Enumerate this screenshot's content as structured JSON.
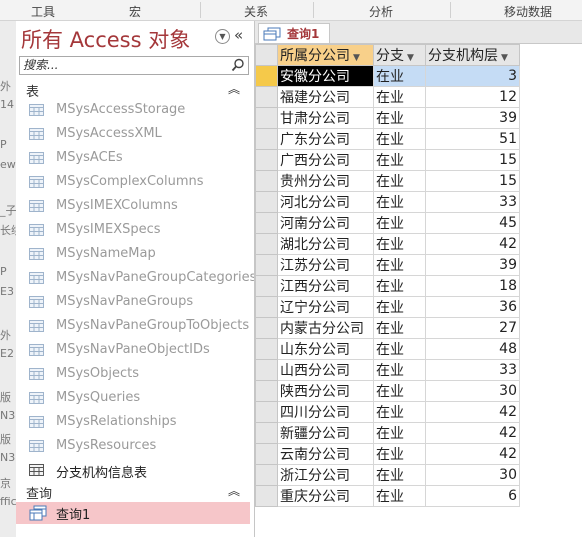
{
  "ribbon": {
    "groups": [
      "工具",
      "宏",
      "关系",
      "分析",
      "移动数据"
    ]
  },
  "left_strip": {
    "fragments": [
      "外",
      "14",
      "P",
      "ew",
      "_子",
      "长续",
      "P",
      "E3",
      "外",
      "E2",
      "版",
      "N3",
      "版",
      "N3",
      "京",
      "ffic"
    ]
  },
  "nav": {
    "title": "所有 Access 对象",
    "search_placeholder": "搜索...",
    "tables_header": "表",
    "tables": [
      "MSysAccessStorage",
      "MSysAccessXML",
      "MSysACEs",
      "MSysComplexColumns",
      "MSysIMEXColumns",
      "MSysIMEXSpecs",
      "MSysNameMap",
      "MSysNavPaneGroupCategories",
      "MSysNavPaneGroups",
      "MSysNavPaneGroupToObjects",
      "MSysNavPaneObjectIDs",
      "MSysObjects",
      "MSysQueries",
      "MSysRelationships",
      "MSysResources",
      "分支机构信息表"
    ],
    "queries_header": "查询",
    "queries": [
      "查询1"
    ]
  },
  "document": {
    "tab_label": "查询1",
    "columns": [
      "所属分公司",
      "分支",
      "分支机构层"
    ],
    "rows": [
      [
        "安徽分公司",
        "在业",
        "3"
      ],
      [
        "福建分公司",
        "在业",
        "12"
      ],
      [
        "甘肃分公司",
        "在业",
        "39"
      ],
      [
        "广东分公司",
        "在业",
        "51"
      ],
      [
        "广西分公司",
        "在业",
        "15"
      ],
      [
        "贵州分公司",
        "在业",
        "15"
      ],
      [
        "河北分公司",
        "在业",
        "33"
      ],
      [
        "河南分公司",
        "在业",
        "45"
      ],
      [
        "湖北分公司",
        "在业",
        "42"
      ],
      [
        "江苏分公司",
        "在业",
        "39"
      ],
      [
        "江西分公司",
        "在业",
        "18"
      ],
      [
        "辽宁分公司",
        "在业",
        "36"
      ],
      [
        "内蒙古分公司",
        "在业",
        "27"
      ],
      [
        "山东分公司",
        "在业",
        "48"
      ],
      [
        "山西分公司",
        "在业",
        "33"
      ],
      [
        "陕西分公司",
        "在业",
        "30"
      ],
      [
        "四川分公司",
        "在业",
        "42"
      ],
      [
        "新疆分公司",
        "在业",
        "42"
      ],
      [
        "云南分公司",
        "在业",
        "42"
      ],
      [
        "浙江分公司",
        "在业",
        "30"
      ],
      [
        "重庆分公司",
        "在业",
        "6"
      ]
    ]
  },
  "colors": {
    "accent": "#a4373a",
    "selected_nav_item": "#f6c6c9",
    "selected_row": "#c5dcf5",
    "column_header_selected": "#f8d08a"
  },
  "icons": {
    "nav_menu": "chevron-down-circle-icon",
    "nav_collapse": "double-chevron-left-icon",
    "search": "magnifier-icon",
    "table": "table-icon",
    "query": "query-icon",
    "group_collapse": "double-chevron-up-icon",
    "column_filter": "dropdown-arrow-icon"
  }
}
